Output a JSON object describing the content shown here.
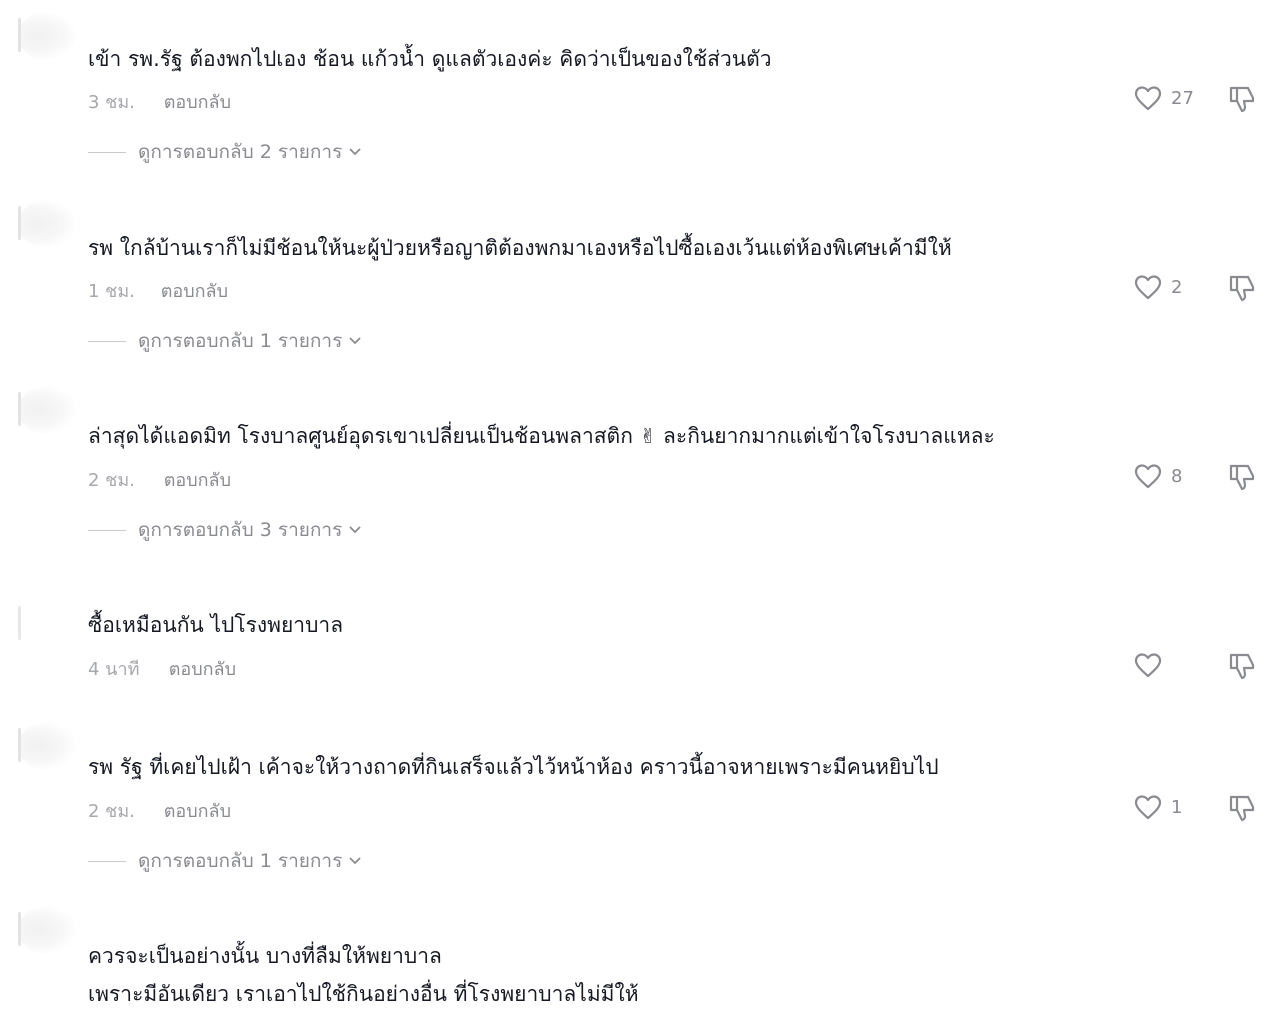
{
  "comments": [
    {
      "text": "เข้า รพ.รัฐ ต้องพกไปเอง ช้อน แก้วน้ำ ดูแลตัวเองค่ะ คิดว่าเป็นของใช้ส่วนตัว",
      "time": "3 ชม.",
      "reply_label": "ตอบกลับ",
      "likes": "27",
      "view_replies": "ดูการตอบกลับ 2 รายการ"
    },
    {
      "text": "รพ ใกล้บ้านเราก็ไม่มีช้อนให้นะผู้ป่วยหรือญาติต้องพกมาเองหรือไปซื้อเองเว้นแต่ห้องพิเศษเค้ามีให้",
      "time": "1 ชม.",
      "reply_label": "ตอบกลับ",
      "likes": "2",
      "view_replies": "ดูการตอบกลับ 1 รายการ"
    },
    {
      "text_before_emoji": "ล่าสุดได้แอดมิท โรงบาลศูนย์อุดรเขาเปลี่ยนเป็นช้อนพลาสติก",
      "emoji": "✌",
      "text_after_emoji": "ละกินยากมากแต่เข้าใจโรงบาลแหละ",
      "time": "2 ชม.",
      "reply_label": "ตอบกลับ",
      "likes": "8",
      "view_replies": "ดูการตอบกลับ 3 รายการ"
    },
    {
      "text": "ซื้อเหมือนกัน ไปโรงพยาบาล",
      "time": "4 นาที",
      "reply_label": "ตอบกลับ"
    },
    {
      "text": "รพ รัฐ ที่เคยไปเฝ้า เค้าจะให้วางถาดที่กินเสร็จแล้วไว้หน้าห้อง คราวนี้อาจหายเพราะมีคนหยิบไป",
      "time": "2 ชม.",
      "reply_label": "ตอบกลับ",
      "likes": "1",
      "view_replies": "ดูการตอบกลับ 1 รายการ"
    },
    {
      "text_line1": "ควรจะเป็นอย่างนั้น บางที่ลืมให้พยาบาล",
      "text_line2": "เพราะมีอันเดียว เราเอาไปใช้กินอย่างอื่น ที่โรงพยาบาลไม่มีให้"
    }
  ],
  "icons": {
    "like": "heart-outline-icon",
    "dislike": "thumbs-down-outline-icon",
    "expand": "chevron-down-icon"
  },
  "colors": {
    "text": "#161823",
    "muted": "#a7a8ac",
    "icon": "#8a8b91"
  }
}
